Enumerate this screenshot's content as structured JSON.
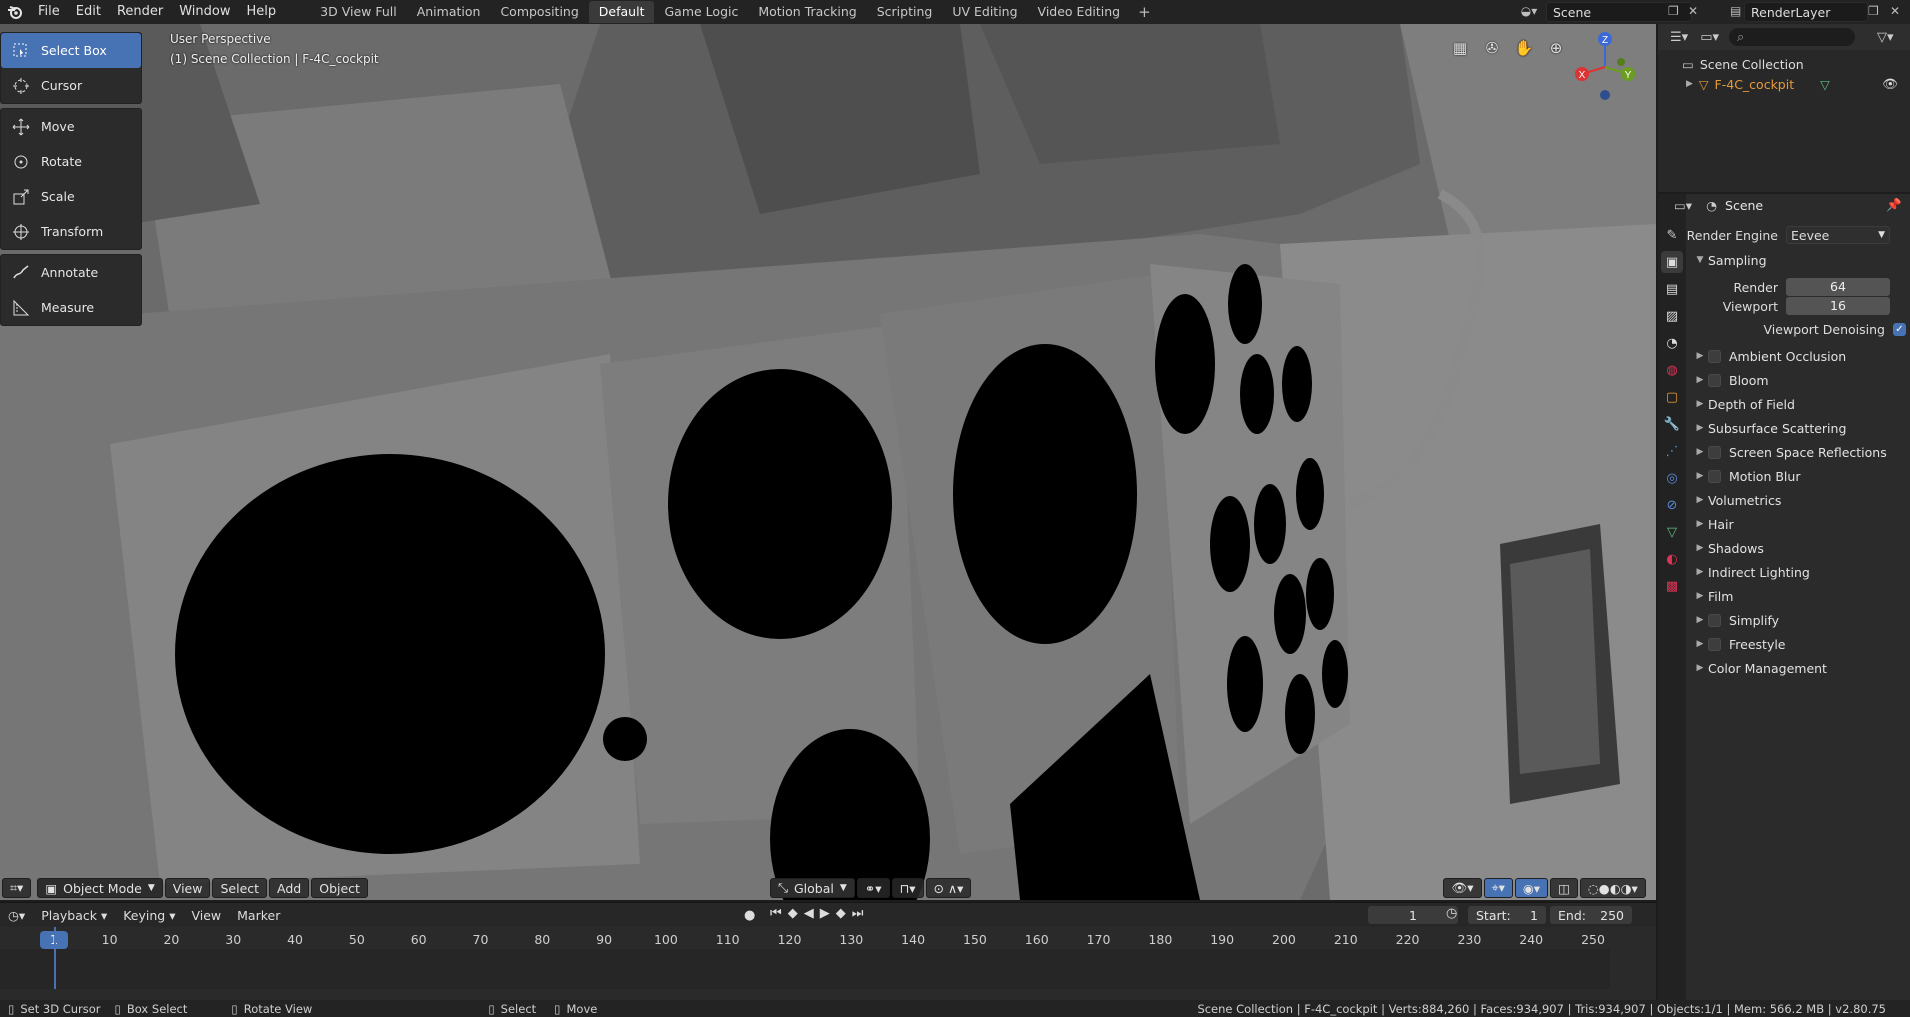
{
  "app": {
    "menu": [
      "File",
      "Edit",
      "Render",
      "Window",
      "Help"
    ],
    "workspaces": [
      "3D View Full",
      "Animation",
      "Compositing",
      "Default",
      "Game Logic",
      "Motion Tracking",
      "Scripting",
      "UV Editing",
      "Video Editing"
    ],
    "active_workspace": "Default",
    "scene_name": "Scene",
    "render_layer": "RenderLayer"
  },
  "viewport": {
    "perspective_label": "User Perspective",
    "collection_label": "(1) Scene Collection | F-4C_cockpit",
    "tools": [
      {
        "label": "Select Box",
        "icon": "select-box-icon",
        "active": true
      },
      {
        "label": "Cursor",
        "icon": "cursor-icon"
      },
      {
        "label": "Move",
        "icon": "move-icon"
      },
      {
        "label": "Rotate",
        "icon": "rotate-icon"
      },
      {
        "label": "Scale",
        "icon": "scale-icon"
      },
      {
        "label": "Transform",
        "icon": "transform-icon"
      },
      {
        "label": "Annotate",
        "icon": "annotate-icon"
      },
      {
        "label": "Measure",
        "icon": "measure-icon"
      }
    ],
    "gizmo": {
      "x": "X",
      "y": "Y",
      "z": "Z"
    },
    "header": {
      "mode": "Object Mode",
      "view": "View",
      "select": "Select",
      "add": "Add",
      "object": "Object",
      "orientation": "Global"
    }
  },
  "timeline": {
    "menus": [
      "Playback",
      "Keying",
      "View",
      "Marker"
    ],
    "current_frame": "1",
    "start_label": "Start:",
    "start": "1",
    "end_label": "End:",
    "end": "250",
    "ruler": [
      "1",
      "10",
      "20",
      "30",
      "40",
      "50",
      "60",
      "70",
      "80",
      "90",
      "100",
      "110",
      "120",
      "130",
      "140",
      "150",
      "160",
      "170",
      "180",
      "190",
      "200",
      "210",
      "220",
      "230",
      "240",
      "250"
    ]
  },
  "statusbar": {
    "hint1": "Set 3D Cursor",
    "hint2": "Box Select",
    "hint3": "Rotate View",
    "hint4": "Select",
    "hint5": "Move",
    "stats": "Scene Collection | F-4C_cockpit | Verts:884,260 | Faces:934,907 | Tris:934,907 | Objects:1/1 | Mem: 566.2 MB | v2.80.75"
  },
  "outliner": {
    "root": "Scene Collection",
    "object": "F-4C_cockpit"
  },
  "properties": {
    "context": "Scene",
    "render_engine_label": "Render Engine",
    "render_engine": "Eevee",
    "sampling": "Sampling",
    "render_label": "Render",
    "render_value": "64",
    "viewport_label": "Viewport",
    "viewport_value": "16",
    "denoise_label": "Viewport Denoising",
    "panels": [
      {
        "label": "Ambient Occlusion",
        "checkbox": true
      },
      {
        "label": "Bloom",
        "checkbox": true
      },
      {
        "label": "Depth of Field",
        "checkbox": false
      },
      {
        "label": "Subsurface Scattering",
        "checkbox": false
      },
      {
        "label": "Screen Space Reflections",
        "checkbox": true
      },
      {
        "label": "Motion Blur",
        "checkbox": true
      },
      {
        "label": "Volumetrics",
        "checkbox": false
      },
      {
        "label": "Hair",
        "checkbox": false
      },
      {
        "label": "Shadows",
        "checkbox": false
      },
      {
        "label": "Indirect Lighting",
        "checkbox": false
      },
      {
        "label": "Film",
        "checkbox": false
      },
      {
        "label": "Simplify",
        "checkbox": true
      },
      {
        "label": "Freestyle",
        "checkbox": true
      },
      {
        "label": "Color Management",
        "checkbox": false
      }
    ]
  },
  "colors": {
    "accent": "#4772b3",
    "object_orange": "#e59a3a",
    "viewport_gray": "#6f6f6f"
  }
}
